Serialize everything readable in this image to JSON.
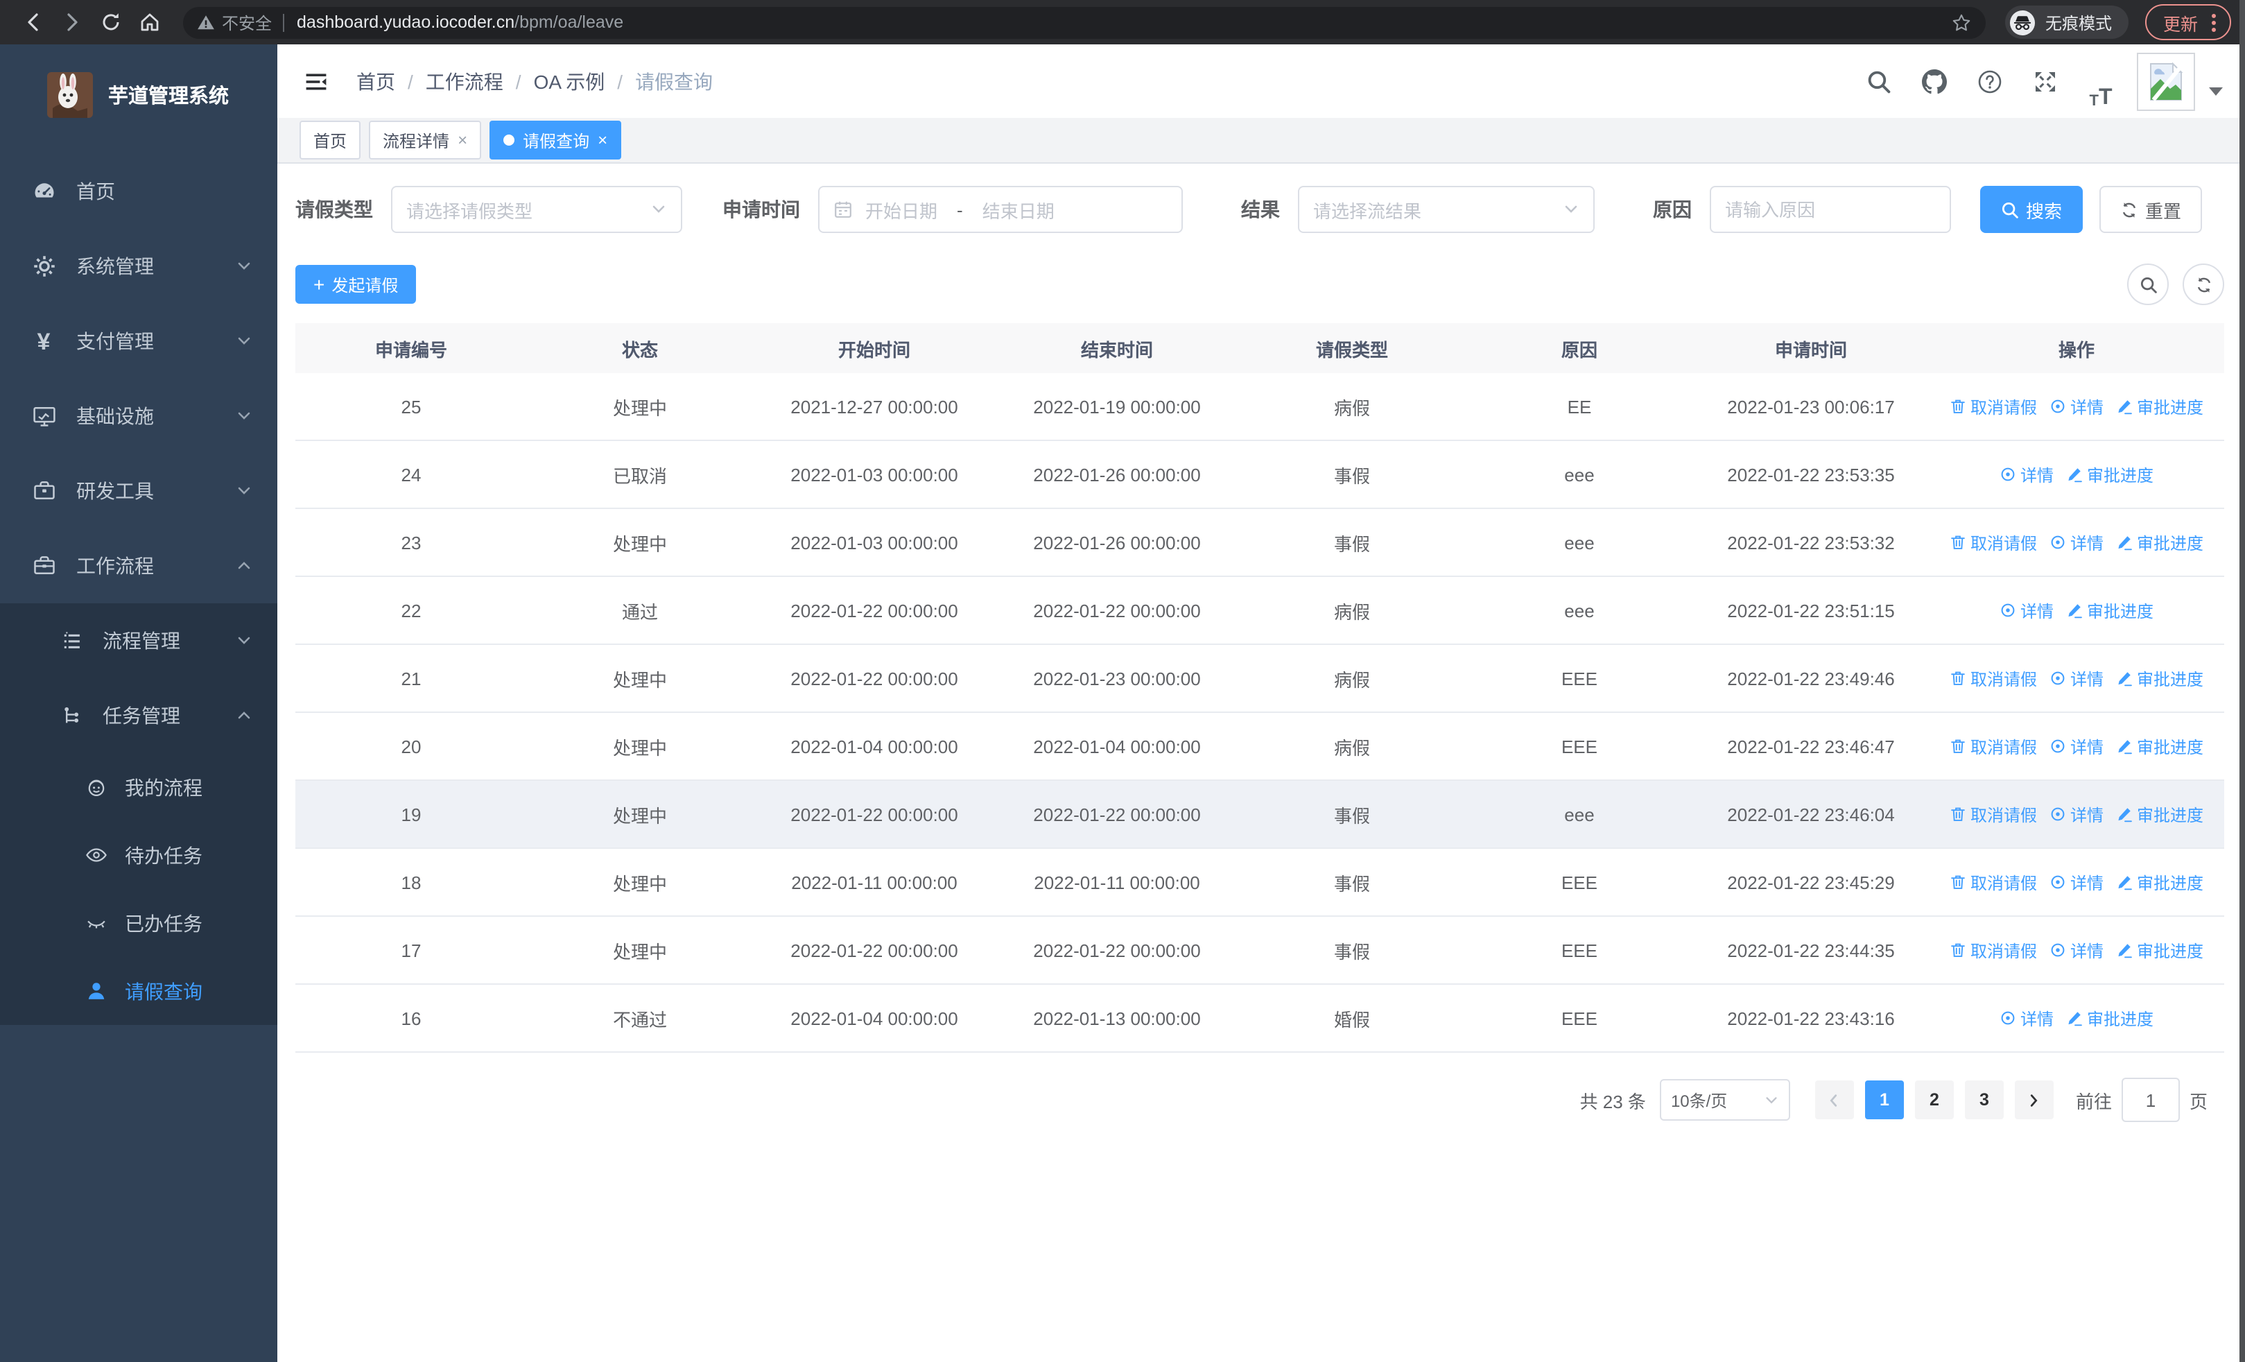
{
  "browser": {
    "warning_label": "不安全",
    "url_host": "dashboard.yudao.iocoder.cn",
    "url_path": "/bpm/oa/leave",
    "incognito_label": "无痕模式",
    "update_label": "更新"
  },
  "icons": {
    "close": "×",
    "plus": "+",
    "t": "T",
    "question": "?",
    "yen": "¥"
  },
  "sidebar": {
    "title": "芋道管理系统",
    "menu": [
      {
        "label": "首页"
      },
      {
        "label": "系统管理"
      },
      {
        "label": "支付管理"
      },
      {
        "label": "基础设施"
      },
      {
        "label": "研发工具"
      },
      {
        "label": "工作流程"
      }
    ],
    "submenu": [
      {
        "label": "流程管理"
      },
      {
        "label": "任务管理"
      }
    ],
    "task_items": [
      {
        "label": "我的流程"
      },
      {
        "label": "待办任务"
      },
      {
        "label": "已办任务"
      },
      {
        "label": "请假查询"
      }
    ]
  },
  "breadcrumb": {
    "separator": "/",
    "items": [
      "首页",
      "工作流程",
      "OA 示例",
      "请假查询"
    ]
  },
  "tabs": [
    {
      "label": "首页"
    },
    {
      "label": "流程详情"
    },
    {
      "label": "请假查询"
    }
  ],
  "filters": {
    "leave_type_label": "请假类型",
    "leave_type_placeholder": "请选择请假类型",
    "apply_time_label": "申请时间",
    "start_placeholder": "开始日期",
    "range_separator": "-",
    "end_placeholder": "结束日期",
    "result_label": "结果",
    "result_placeholder": "请选择流结果",
    "reason_label": "原因",
    "reason_placeholder": "请输入原因",
    "search_label": "搜索",
    "reset_label": "重置"
  },
  "toolbar": {
    "create_label": "发起请假"
  },
  "table": {
    "columns": [
      "申请编号",
      "状态",
      "开始时间",
      "结束时间",
      "请假类型",
      "原因",
      "申请时间",
      "操作"
    ],
    "actions": {
      "cancel": "取消请假",
      "detail": "详情",
      "progress": "审批进度"
    },
    "rows": [
      {
        "id": "25",
        "status": "处理中",
        "start": "2021-12-27 00:00:00",
        "end": "2022-01-19 00:00:00",
        "type": "病假",
        "reason": "EE",
        "applied": "2022-01-23 00:06:17"
      },
      {
        "id": "24",
        "status": "已取消",
        "start": "2022-01-03 00:00:00",
        "end": "2022-01-26 00:00:00",
        "type": "事假",
        "reason": "eee",
        "applied": "2022-01-22 23:53:35"
      },
      {
        "id": "23",
        "status": "处理中",
        "start": "2022-01-03 00:00:00",
        "end": "2022-01-26 00:00:00",
        "type": "事假",
        "reason": "eee",
        "applied": "2022-01-22 23:53:32"
      },
      {
        "id": "22",
        "status": "通过",
        "start": "2022-01-22 00:00:00",
        "end": "2022-01-22 00:00:00",
        "type": "病假",
        "reason": "eee",
        "applied": "2022-01-22 23:51:15"
      },
      {
        "id": "21",
        "status": "处理中",
        "start": "2022-01-22 00:00:00",
        "end": "2022-01-23 00:00:00",
        "type": "病假",
        "reason": "EEE",
        "applied": "2022-01-22 23:49:46"
      },
      {
        "id": "20",
        "status": "处理中",
        "start": "2022-01-04 00:00:00",
        "end": "2022-01-04 00:00:00",
        "type": "病假",
        "reason": "EEE",
        "applied": "2022-01-22 23:46:47"
      },
      {
        "id": "19",
        "status": "处理中",
        "start": "2022-01-22 00:00:00",
        "end": "2022-01-22 00:00:00",
        "type": "事假",
        "reason": "eee",
        "applied": "2022-01-22 23:46:04"
      },
      {
        "id": "18",
        "status": "处理中",
        "start": "2022-01-11 00:00:00",
        "end": "2022-01-11 00:00:00",
        "type": "事假",
        "reason": "EEE",
        "applied": "2022-01-22 23:45:29"
      },
      {
        "id": "17",
        "status": "处理中",
        "start": "2022-01-22 00:00:00",
        "end": "2022-01-22 00:00:00",
        "type": "事假",
        "reason": "EEE",
        "applied": "2022-01-22 23:44:35"
      },
      {
        "id": "16",
        "status": "不通过",
        "start": "2022-01-04 00:00:00",
        "end": "2022-01-13 00:00:00",
        "type": "婚假",
        "reason": "EEE",
        "applied": "2022-01-22 23:43:16"
      }
    ]
  },
  "pagination": {
    "total": "共 23 条",
    "page_size": "10条/页",
    "pages": [
      "1",
      "2",
      "3"
    ],
    "goto_label": "前往",
    "goto_value": "1",
    "page_unit": "页"
  },
  "colors": {
    "primary": "#409eff",
    "sidebar_bg": "#304156",
    "submenu_bg": "#263445",
    "table_header_bg": "#f8f8f9"
  }
}
